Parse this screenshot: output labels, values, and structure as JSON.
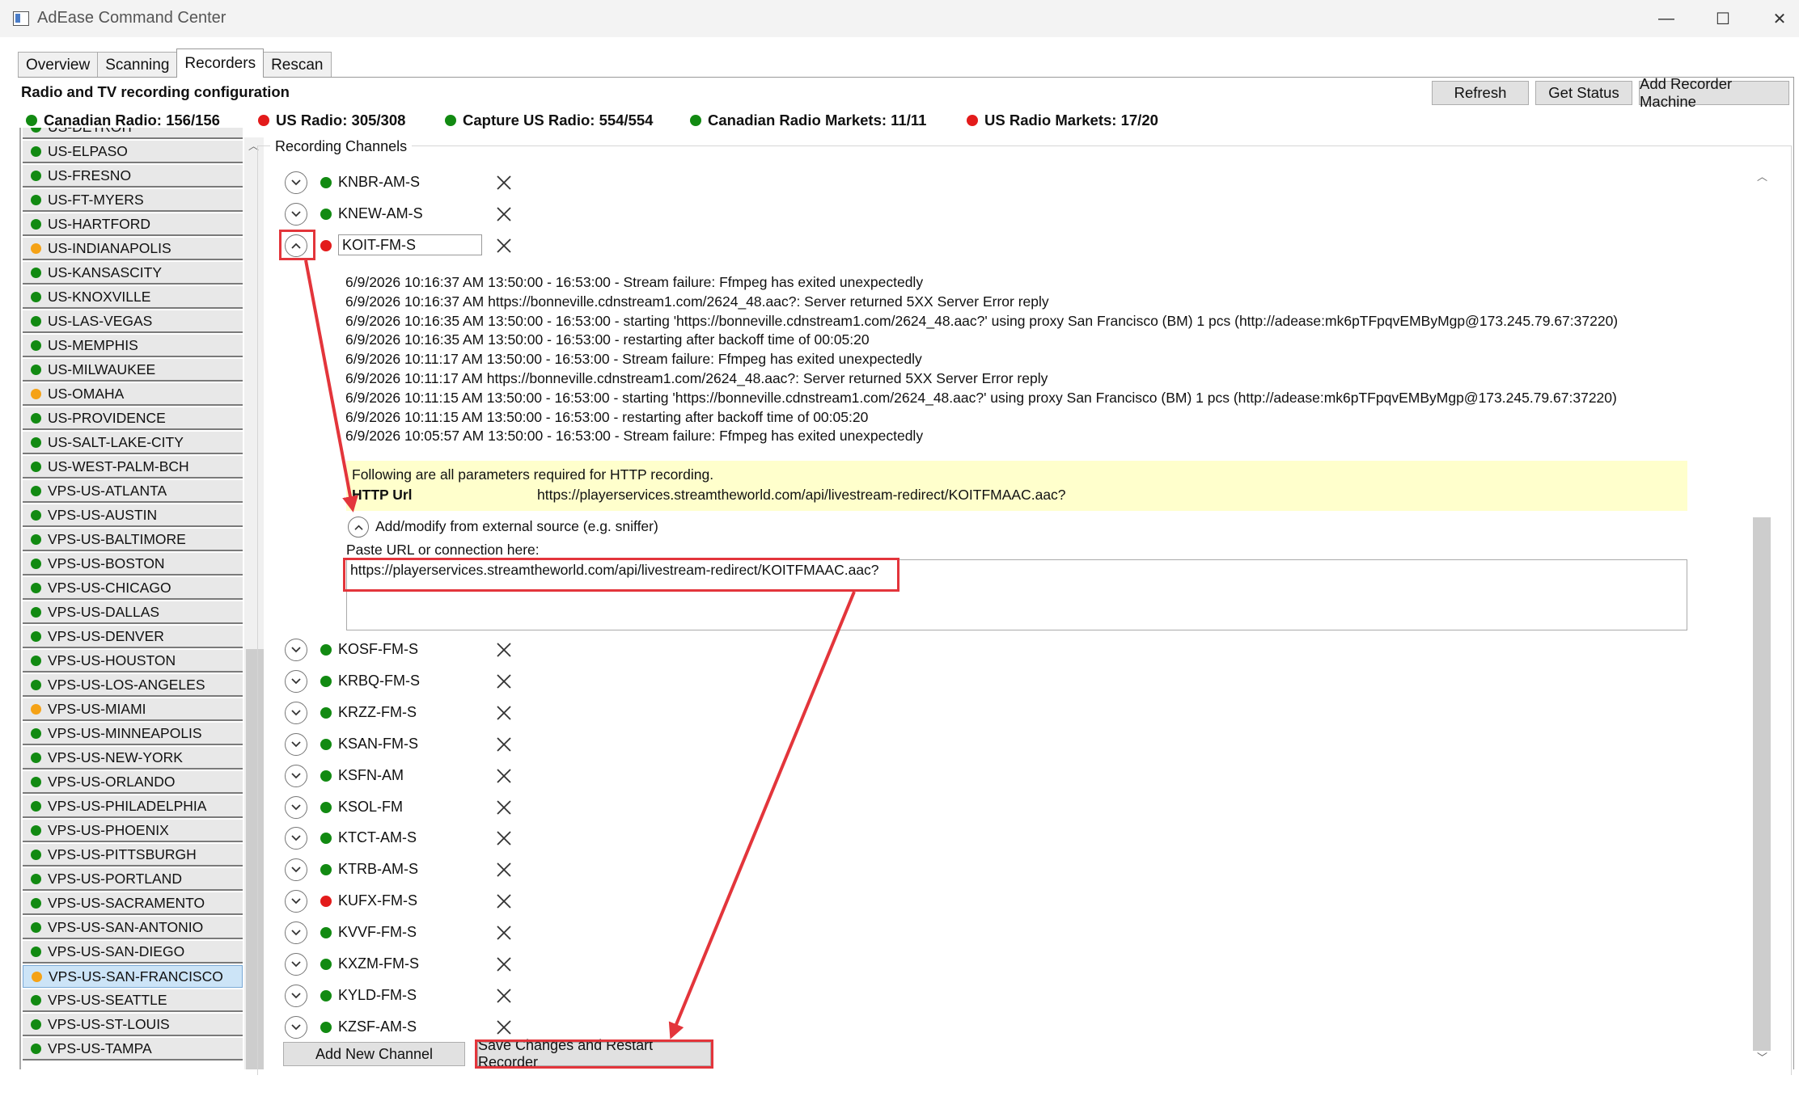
{
  "window": {
    "title": "AdEase Command Center",
    "minimize": "—",
    "maximize": "☐",
    "close": "✕"
  },
  "tabs": [
    "Overview",
    "Scanning",
    "Recorders",
    "Rescan"
  ],
  "active_tab": "Recorders",
  "header": {
    "title": "Radio and TV recording configuration",
    "refresh": "Refresh",
    "get_status": "Get Status",
    "add_recorder": "Add Recorder Machine"
  },
  "status": [
    {
      "label": "Canadian Radio: 156/156",
      "color": "#128a12"
    },
    {
      "label": "US Radio: 305/308",
      "color": "#e31b1b"
    },
    {
      "label": "Capture US Radio: 554/554",
      "color": "#128a12"
    },
    {
      "label": "Canadian Radio Markets: 11/11",
      "color": "#128a12"
    },
    {
      "label": "US Radio Markets: 17/20",
      "color": "#e31b1b"
    }
  ],
  "markets": [
    {
      "name": "US-DETROIT",
      "status": "g"
    },
    {
      "name": "US-ELPASO",
      "status": "g"
    },
    {
      "name": "US-FRESNO",
      "status": "g"
    },
    {
      "name": "US-FT-MYERS",
      "status": "g"
    },
    {
      "name": "US-HARTFORD",
      "status": "g"
    },
    {
      "name": "US-INDIANAPOLIS",
      "status": "o"
    },
    {
      "name": "US-KANSASCITY",
      "status": "g"
    },
    {
      "name": "US-KNOXVILLE",
      "status": "g"
    },
    {
      "name": "US-LAS-VEGAS",
      "status": "g"
    },
    {
      "name": "US-MEMPHIS",
      "status": "g"
    },
    {
      "name": "US-MILWAUKEE",
      "status": "g"
    },
    {
      "name": "US-OMAHA",
      "status": "o"
    },
    {
      "name": "US-PROVIDENCE",
      "status": "g"
    },
    {
      "name": "US-SALT-LAKE-CITY",
      "status": "g"
    },
    {
      "name": "US-WEST-PALM-BCH",
      "status": "g"
    },
    {
      "name": "VPS-US-ATLANTA",
      "status": "g"
    },
    {
      "name": "VPS-US-AUSTIN",
      "status": "g"
    },
    {
      "name": "VPS-US-BALTIMORE",
      "status": "g"
    },
    {
      "name": "VPS-US-BOSTON",
      "status": "g"
    },
    {
      "name": "VPS-US-CHICAGO",
      "status": "g"
    },
    {
      "name": "VPS-US-DALLAS",
      "status": "g"
    },
    {
      "name": "VPS-US-DENVER",
      "status": "g"
    },
    {
      "name": "VPS-US-HOUSTON",
      "status": "g"
    },
    {
      "name": "VPS-US-LOS-ANGELES",
      "status": "g"
    },
    {
      "name": "VPS-US-MIAMI",
      "status": "o"
    },
    {
      "name": "VPS-US-MINNEAPOLIS",
      "status": "g"
    },
    {
      "name": "VPS-US-NEW-YORK",
      "status": "g"
    },
    {
      "name": "VPS-US-ORLANDO",
      "status": "g"
    },
    {
      "name": "VPS-US-PHILADELPHIA",
      "status": "g"
    },
    {
      "name": "VPS-US-PHOENIX",
      "status": "g"
    },
    {
      "name": "VPS-US-PITTSBURGH",
      "status": "g"
    },
    {
      "name": "VPS-US-PORTLAND",
      "status": "g"
    },
    {
      "name": "VPS-US-SACRAMENTO",
      "status": "g"
    },
    {
      "name": "VPS-US-SAN-ANTONIO",
      "status": "g"
    },
    {
      "name": "VPS-US-SAN-DIEGO",
      "status": "g"
    },
    {
      "name": "VPS-US-SAN-FRANCISCO",
      "status": "o",
      "selected": true
    },
    {
      "name": "VPS-US-SEATTLE",
      "status": "g"
    },
    {
      "name": "VPS-US-ST-LOUIS",
      "status": "g"
    },
    {
      "name": "VPS-US-TAMPA",
      "status": "g"
    }
  ],
  "channels_group_label": "Recording Channels",
  "channels_top": [
    {
      "name": "KNBR-AM-S",
      "status": "g"
    },
    {
      "name": "KNEW-AM-S",
      "status": "g"
    }
  ],
  "expanded_channel": {
    "name": "KOIT-FM-S",
    "status": "r",
    "log": [
      "6/9/2026 10:16:37 AM 13:50:00 - 16:53:00 - Stream failure: Ffmpeg has exited unexpectedly",
      "6/9/2026 10:16:37 AM https://bonneville.cdnstream1.com/2624_48.aac?: Server returned 5XX Server Error reply",
      "6/9/2026 10:16:35 AM 13:50:00 - 16:53:00 - starting 'https://bonneville.cdnstream1.com/2624_48.aac?' using proxy San Francisco (BM) 1 pcs (http://adease:mk6pTFpqvEMByMgp@173.245.79.67:37220)",
      "6/9/2026 10:16:35 AM 13:50:00 - 16:53:00 - restarting after backoff time of 00:05:20",
      "6/9/2026 10:11:17 AM 13:50:00 - 16:53:00 - Stream failure: Ffmpeg has exited unexpectedly",
      "6/9/2026 10:11:17 AM https://bonneville.cdnstream1.com/2624_48.aac?: Server returned 5XX Server Error reply",
      "6/9/2026 10:11:15 AM 13:50:00 - 16:53:00 - starting 'https://bonneville.cdnstream1.com/2624_48.aac?' using proxy San Francisco (BM) 1 pcs (http://adease:mk6pTFpqvEMByMgp@173.245.79.67:37220)",
      "6/9/2026 10:11:15 AM 13:50:00 - 16:53:00 - restarting after backoff time of 00:05:20",
      "6/9/2026 10:05:57 AM 13:50:00 - 16:53:00 - Stream failure: Ffmpeg has exited unexpectedly"
    ],
    "params_hint": "Following are all parameters required for HTTP recording.",
    "param_key": "HTTP Url",
    "param_value": "https://playerservices.streamtheworld.com/api/livestream-redirect/KOITFMAAC.aac?",
    "external_label": "Add/modify from external source (e.g. sniffer)",
    "paste_label": "Paste URL or connection here:",
    "paste_value": "https://playerservices.streamtheworld.com/api/livestream-redirect/KOITFMAAC.aac?"
  },
  "channels_bottom": [
    {
      "name": "KOSF-FM-S",
      "status": "g"
    },
    {
      "name": "KRBQ-FM-S",
      "status": "g"
    },
    {
      "name": "KRZZ-FM-S",
      "status": "g"
    },
    {
      "name": "KSAN-FM-S",
      "status": "g"
    },
    {
      "name": "KSFN-AM",
      "status": "g"
    },
    {
      "name": "KSOL-FM",
      "status": "g"
    },
    {
      "name": "KTCT-AM-S",
      "status": "g"
    },
    {
      "name": "KTRB-AM-S",
      "status": "g"
    },
    {
      "name": "KUFX-FM-S",
      "status": "r"
    },
    {
      "name": "KVVF-FM-S",
      "status": "g"
    },
    {
      "name": "KXZM-FM-S",
      "status": "g"
    },
    {
      "name": "KYLD-FM-S",
      "status": "g"
    },
    {
      "name": "KZSF-AM-S",
      "status": "g"
    }
  ],
  "buttons": {
    "add_channel": "Add New Channel",
    "save_restart": "Save Changes and Restart Recorder"
  }
}
